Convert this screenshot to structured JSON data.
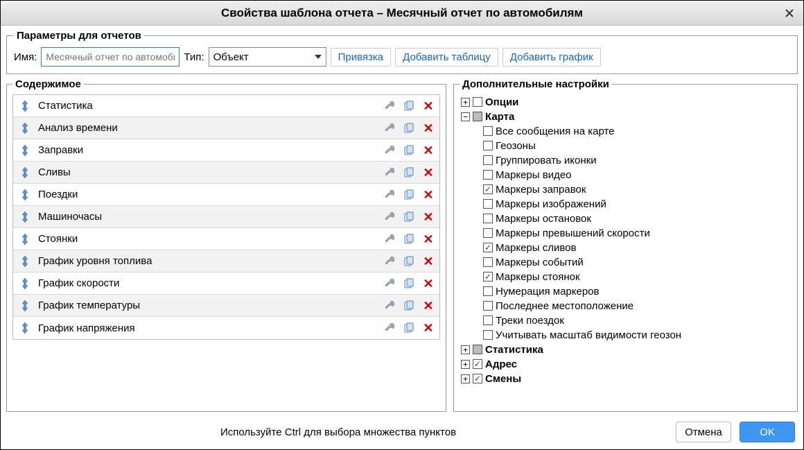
{
  "title": "Свойства шаблона отчета – Месячный отчет по автомобилям",
  "params": {
    "legend": "Параметры для отчетов",
    "name_label": "Имя:",
    "name_placeholder": "Месячный отчет по автомобилям",
    "type_label": "Тип:",
    "type_value": "Объект",
    "bind_btn": "Привязка",
    "add_table_btn": "Добавить таблицу",
    "add_chart_btn": "Добавить график"
  },
  "content": {
    "legend": "Содержимое",
    "items": [
      {
        "label": "Статистика"
      },
      {
        "label": "Анализ времени"
      },
      {
        "label": "Заправки"
      },
      {
        "label": "Сливы"
      },
      {
        "label": "Поездки"
      },
      {
        "label": "Машиночасы"
      },
      {
        "label": "Стоянки"
      },
      {
        "label": "График уровня топлива"
      },
      {
        "label": "График скорости"
      },
      {
        "label": "График температуры"
      },
      {
        "label": "График напряжения"
      }
    ]
  },
  "settings": {
    "legend": "Дополнительные настройки",
    "nodes": [
      {
        "label": "Опции",
        "bold": true,
        "expanded": false,
        "check": "off"
      },
      {
        "label": "Карта",
        "bold": true,
        "expanded": true,
        "check": "mixed",
        "children": [
          {
            "label": "Все сообщения на карте",
            "check": "off"
          },
          {
            "label": "Геозоны",
            "check": "off"
          },
          {
            "label": "Группировать иконки",
            "check": "off"
          },
          {
            "label": "Маркеры видео",
            "check": "off"
          },
          {
            "label": "Маркеры заправок",
            "check": "on"
          },
          {
            "label": "Маркеры изображений",
            "check": "off"
          },
          {
            "label": "Маркеры остановок",
            "check": "off"
          },
          {
            "label": "Маркеры превышений скорости",
            "check": "off"
          },
          {
            "label": "Маркеры сливов",
            "check": "on"
          },
          {
            "label": "Маркеры событий",
            "check": "off"
          },
          {
            "label": "Маркеры стоянок",
            "check": "on"
          },
          {
            "label": "Нумерация маркеров",
            "check": "off"
          },
          {
            "label": "Последнее местоположение",
            "check": "off"
          },
          {
            "label": "Треки поездок",
            "check": "off"
          },
          {
            "label": "Учитывать масштаб видимости геозон",
            "check": "off"
          }
        ]
      },
      {
        "label": "Статистика",
        "bold": true,
        "expanded": false,
        "check": "mixed"
      },
      {
        "label": "Адрес",
        "bold": true,
        "expanded": false,
        "check": "on"
      },
      {
        "label": "Смены",
        "bold": true,
        "expanded": false,
        "check": "on"
      }
    ]
  },
  "footer": {
    "hint": "Используйте Ctrl для выбора множества пунктов",
    "cancel": "Отмена",
    "ok": "OK"
  }
}
